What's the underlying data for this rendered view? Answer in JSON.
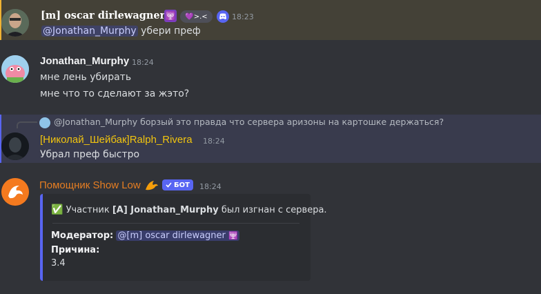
{
  "messages": [
    {
      "author": "[m] oscar dirlewagner",
      "menorah_badge": "🕎",
      "pill_text": "💜>.<",
      "time": "18:23",
      "mention": "@Jonathan_Murphy",
      "text": "убери преф"
    },
    {
      "author": "Jonathan_Murphy",
      "time": "18:24",
      "lines": [
        "мне лень убирать",
        "мне что то сделают за жэто?"
      ]
    },
    {
      "reply_mention": "@Jonathan_Murphy",
      "reply_text": "борзый это правда что сервера аризоны на картошке держаться?",
      "author": "[Николай_Шейбак]Ralph_Rivera",
      "time": "18:24",
      "text": "Убрал преф быстро"
    },
    {
      "author": "Помощник Show Low",
      "bot_label": "БОТ",
      "time": "18:24",
      "embed": {
        "check": "✅",
        "title_pre": "Участник ",
        "title_bold": "[A] Jonathan_Murphy",
        "title_post": " был изгнан с сервера.",
        "moderator_label": "Модератор:",
        "moderator_mention": "@[m] oscar dirlewagner",
        "moderator_emoji": "🕎",
        "reason_label": "Причина:",
        "reason_value": "3.4"
      }
    }
  ],
  "colors": {
    "background": "#313338",
    "highlight_mention": "#444137",
    "highlight_reply": "#393b4d",
    "ralph_name": "#f1c40f",
    "bot_name": "#e67e22",
    "accent": "#5865f2"
  }
}
